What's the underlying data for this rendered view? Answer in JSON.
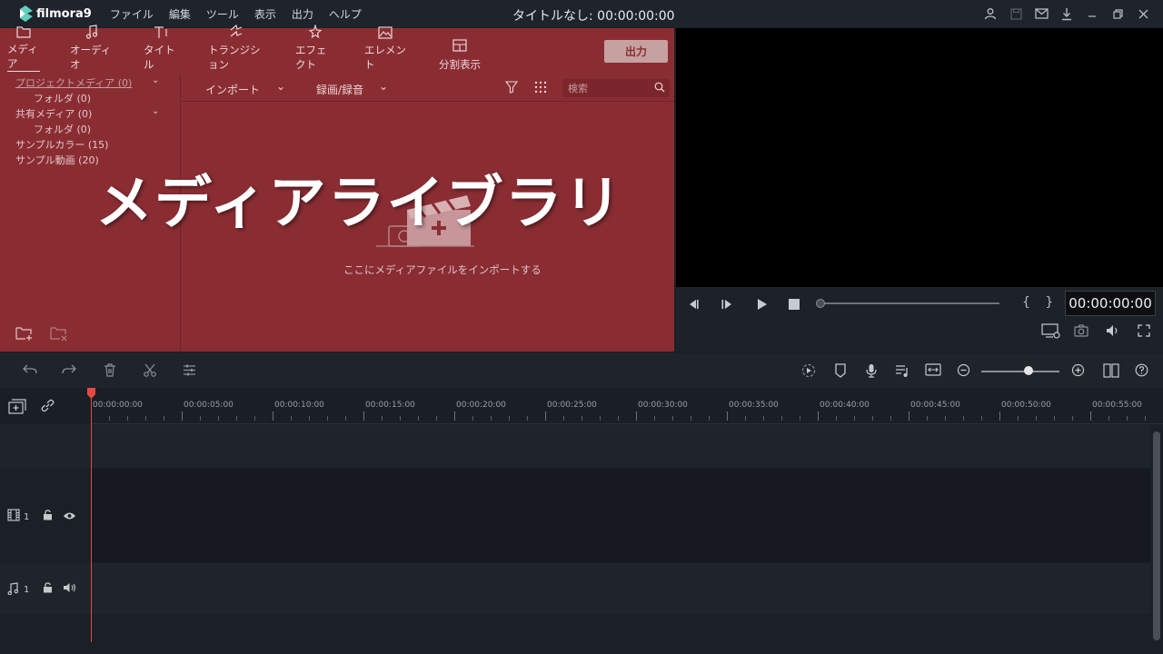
{
  "app": {
    "name": "filmora9",
    "document_title": "タイトルなし: 00:00:00:00"
  },
  "menu": [
    "ファイル",
    "編集",
    "ツール",
    "表示",
    "出力",
    "ヘルプ"
  ],
  "window_icons": [
    "user-icon",
    "save-icon",
    "mail-icon",
    "download-icon",
    "minimize-icon",
    "restore-icon",
    "close-icon"
  ],
  "media_tabs": [
    {
      "label": "メディア",
      "icon": "folder-icon",
      "active": true
    },
    {
      "label": "オーディオ",
      "icon": "music-note-icon"
    },
    {
      "label": "タイトル",
      "icon": "title-text-icon"
    },
    {
      "label": "トランジション",
      "icon": "transition-icon"
    },
    {
      "label": "エフェクト",
      "icon": "effects-icon"
    },
    {
      "label": "エレメント",
      "icon": "image-element-icon"
    },
    {
      "label": "分割表示",
      "icon": "split-screen-icon"
    }
  ],
  "export_button": "出力",
  "tree": {
    "project_media": "プロジェクトメディア (0)",
    "project_folder": "フォルダ (0)",
    "shared_media": "共有メディア (0)",
    "shared_folder": "フォルダ (0)",
    "sample_colors": "サンプルカラー (15)",
    "sample_videos": "サンプル動画 (20)"
  },
  "media_toolbar": {
    "import": "インポート",
    "record": "録画/録音",
    "search_placeholder": "検索"
  },
  "overlay_title": "メディアライブラリ",
  "empty_message": "ここにメディアファイルをインポートする",
  "preview": {
    "timecode": "00:00:00:00",
    "brackets": "{ }"
  },
  "ruler_labels": [
    "00:00:00:00",
    "00:00:05:00",
    "00:00:10:00",
    "00:00:15:00",
    "00:00:20:00",
    "00:00:25:00",
    "00:00:30:00",
    "00:00:35:00",
    "00:00:40:00",
    "00:00:45:00",
    "00:00:50:00",
    "00:00:55:00"
  ],
  "tracks": {
    "video_number": "1",
    "audio_number": "1"
  },
  "colors": {
    "media_panel": "#8a2d33",
    "playhead": "#e24a42",
    "background": "#1b1f26"
  }
}
